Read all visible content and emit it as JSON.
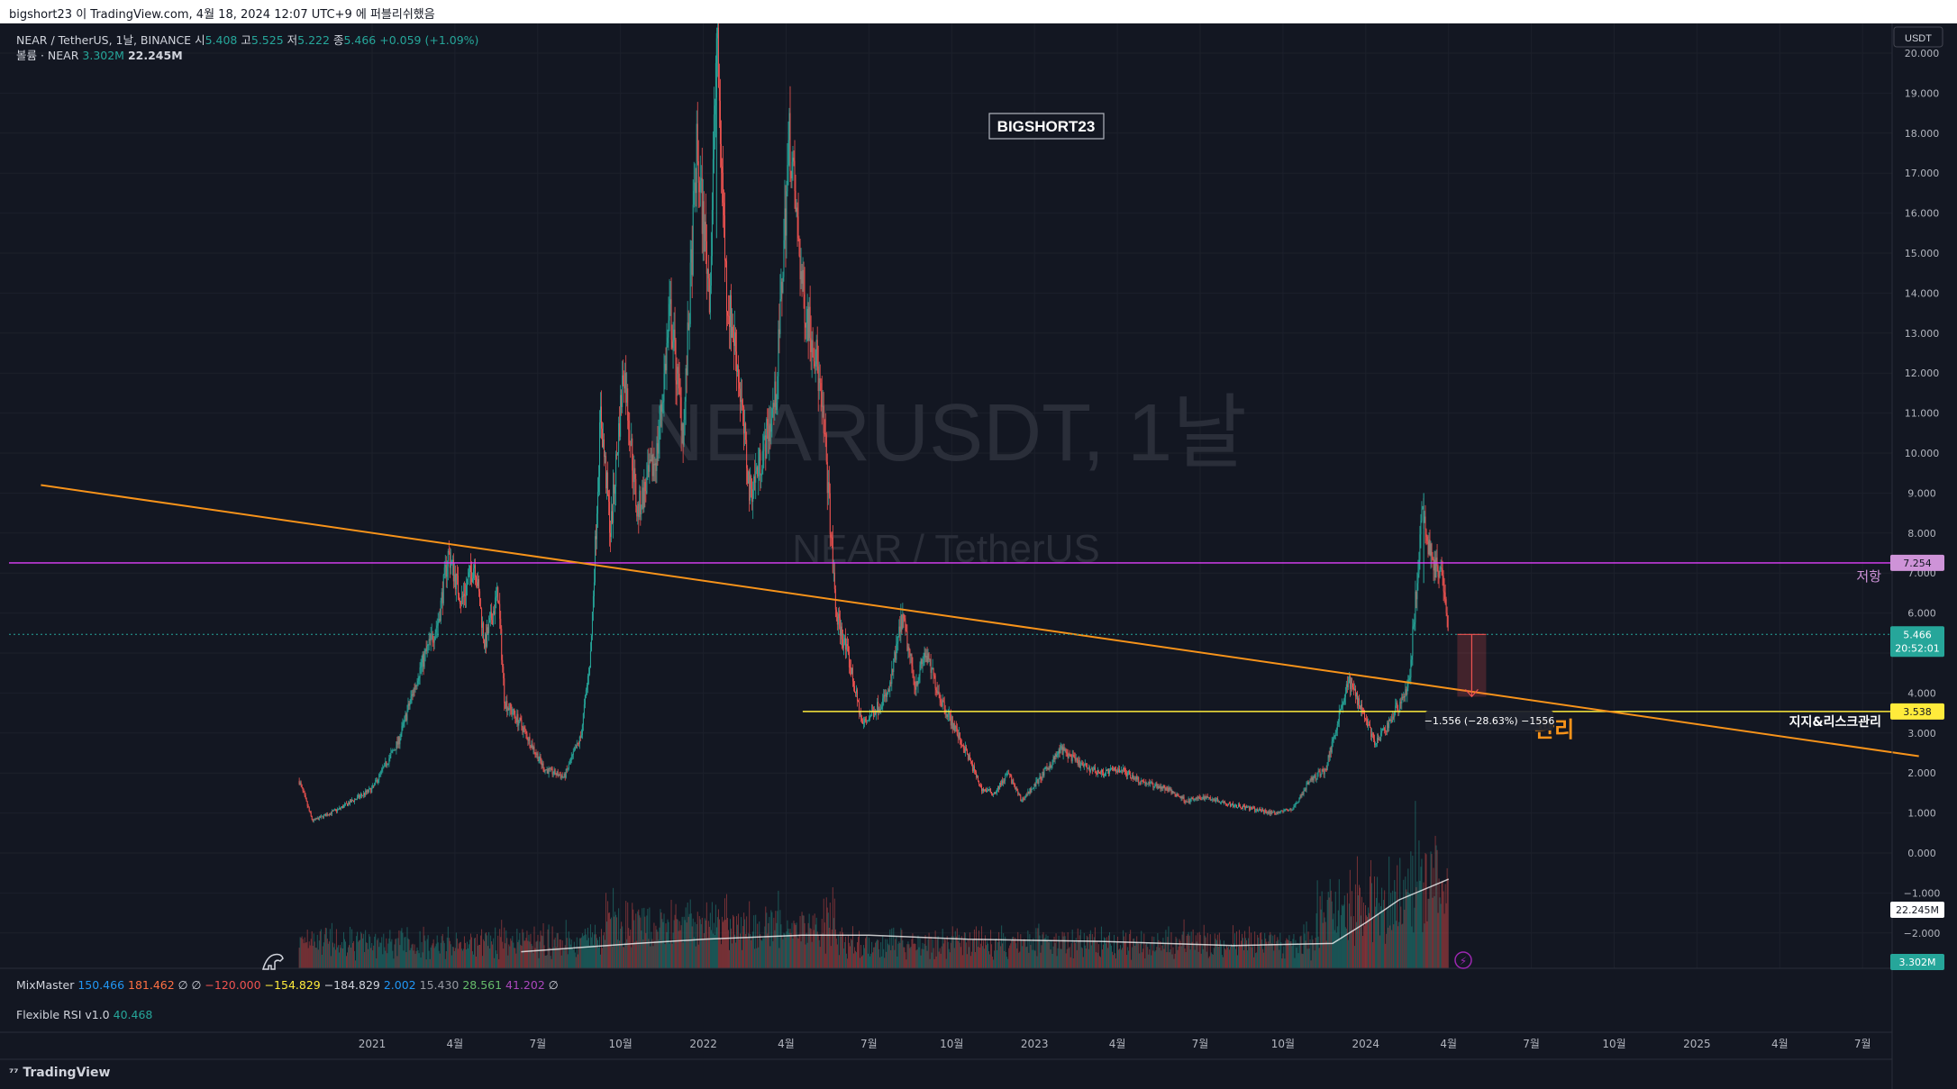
{
  "topbar": {
    "text": "bigshort23 이 TradingView.com, 4월 18, 2024 12:07 UTC+9 에 퍼블리쉬했음"
  },
  "legend": {
    "symbol": "NEAR / TetherUS, 1날, BINANCE",
    "open_label": "시",
    "open": "5.408",
    "high_label": "고",
    "high": "5.525",
    "low_label": "저",
    "low": "5.222",
    "close_label": "종",
    "close": "5.466",
    "change": "+0.059 (+1.09%)",
    "volume_label": "볼륨 · NEAR",
    "volume": "3.302M",
    "volume_ma": "22.245M"
  },
  "watermark": {
    "symbol": "NEARUSDT, 1날",
    "name": "NEAR / TetherUS"
  },
  "author_tag": "BIGSHORT23",
  "currency_button": "USDT",
  "annotations": {
    "resistance_label": "저항",
    "support_label": "지지&리스크관리",
    "support_orange_text": "관리",
    "measure": "−1.556 (−28.63%) −1556"
  },
  "price_tags": {
    "resistance": "7.254",
    "last_price": "5.466",
    "countdown": "20:52:01",
    "support": "3.538",
    "volume_ma": "22.245M",
    "volume": "3.302M"
  },
  "indicators": {
    "mixmaster_name": "MixMaster",
    "mixmaster_values": [
      {
        "v": "150.466",
        "c": "#2196f3"
      },
      {
        "v": "181.462",
        "c": "#ff7043"
      },
      {
        "v": "∅",
        "c": "#d1d4dc"
      },
      {
        "v": "∅",
        "c": "#d1d4dc"
      },
      {
        "v": "−120.000",
        "c": "#ef5350"
      },
      {
        "v": "−154.829",
        "c": "#ffeb3b"
      },
      {
        "v": "−184.829",
        "c": "#d1d4dc"
      },
      {
        "v": "2.002",
        "c": "#2196f3"
      },
      {
        "v": "15.430",
        "c": "#9598a1"
      },
      {
        "v": "28.561",
        "c": "#66bb6a"
      },
      {
        "v": "41.202",
        "c": "#ab47bc"
      },
      {
        "v": "∅",
        "c": "#d1d4dc"
      }
    ],
    "rsi_name": "Flexible RSI v1.0",
    "rsi_value": "40.468"
  },
  "footer": {
    "logo": "TradingView"
  },
  "colors": {
    "background": "#131722",
    "up": "#26a69a",
    "down": "#ef5350",
    "trendline": "#f7931a",
    "resistance": "#e040fb",
    "support": "#ffeb3b"
  },
  "chart_data": {
    "type": "candlestick",
    "title": "NEAR / TetherUS, 1날, BINANCE",
    "y_ticks": [
      "20.000",
      "19.000",
      "18.000",
      "17.000",
      "16.000",
      "15.000",
      "14.000",
      "13.000",
      "12.000",
      "11.000",
      "10.000",
      "9.000",
      "8.000",
      "7.000",
      "6.000",
      "5.000",
      "4.000",
      "3.000",
      "2.000",
      "1.000",
      "0.000",
      "−1.000",
      "−2.000"
    ],
    "ylim": [
      -2.5,
      20.5
    ],
    "x_ticks": [
      {
        "label": "2021",
        "t": 2021.0
      },
      {
        "label": "4월",
        "t": 2021.25
      },
      {
        "label": "7월",
        "t": 2021.5
      },
      {
        "label": "10월",
        "t": 2021.75
      },
      {
        "label": "2022",
        "t": 2022.0
      },
      {
        "label": "4월",
        "t": 2022.25
      },
      {
        "label": "7월",
        "t": 2022.5
      },
      {
        "label": "10월",
        "t": 2022.75
      },
      {
        "label": "2023",
        "t": 2023.0
      },
      {
        "label": "4월",
        "t": 2023.25
      },
      {
        "label": "7월",
        "t": 2023.5
      },
      {
        "label": "10월",
        "t": 2023.75
      },
      {
        "label": "2024",
        "t": 2024.0
      },
      {
        "label": "4월",
        "t": 2024.25
      },
      {
        "label": "7월",
        "t": 2024.5
      },
      {
        "label": "10월",
        "t": 2024.75
      },
      {
        "label": "2025",
        "t": 2025.0
      },
      {
        "label": "4월",
        "t": 2025.25
      },
      {
        "label": "7월",
        "t": 2025.5
      }
    ],
    "price_path": [
      [
        2020.78,
        1.8
      ],
      [
        2020.82,
        0.8
      ],
      [
        2020.9,
        1.1
      ],
      [
        2021.0,
        1.6
      ],
      [
        2021.08,
        2.8
      ],
      [
        2021.14,
        4.5
      ],
      [
        2021.2,
        5.8
      ],
      [
        2021.23,
        7.5
      ],
      [
        2021.27,
        6.3
      ],
      [
        2021.31,
        7.3
      ],
      [
        2021.34,
        5.2
      ],
      [
        2021.38,
        6.5
      ],
      [
        2021.4,
        3.8
      ],
      [
        2021.45,
        3.2
      ],
      [
        2021.52,
        2.1
      ],
      [
        2021.58,
        1.9
      ],
      [
        2021.63,
        2.9
      ],
      [
        2021.66,
        5.0
      ],
      [
        2021.69,
        11.0
      ],
      [
        2021.72,
        8.0
      ],
      [
        2021.76,
        12.2
      ],
      [
        2021.8,
        8.5
      ],
      [
        2021.86,
        10.0
      ],
      [
        2021.9,
        13.5
      ],
      [
        2021.94,
        10.5
      ],
      [
        2021.98,
        17.5
      ],
      [
        2022.02,
        14.0
      ],
      [
        2022.04,
        20.5
      ],
      [
        2022.07,
        14.0
      ],
      [
        2022.1,
        12.5
      ],
      [
        2022.14,
        9.0
      ],
      [
        2022.18,
        10.0
      ],
      [
        2022.22,
        11.5
      ],
      [
        2022.26,
        18.0
      ],
      [
        2022.3,
        14.0
      ],
      [
        2022.34,
        12.5
      ],
      [
        2022.37,
        10.0
      ],
      [
        2022.4,
        6.0
      ],
      [
        2022.44,
        4.8
      ],
      [
        2022.48,
        3.2
      ],
      [
        2022.52,
        3.6
      ],
      [
        2022.56,
        4.0
      ],
      [
        2022.6,
        5.9
      ],
      [
        2022.64,
        4.2
      ],
      [
        2022.67,
        5.0
      ],
      [
        2022.72,
        3.8
      ],
      [
        2022.76,
        3.1
      ],
      [
        2022.8,
        2.4
      ],
      [
        2022.84,
        1.6
      ],
      [
        2022.88,
        1.5
      ],
      [
        2022.92,
        2.0
      ],
      [
        2022.96,
        1.3
      ],
      [
        2023.02,
        1.9
      ],
      [
        2023.08,
        2.6
      ],
      [
        2023.14,
        2.2
      ],
      [
        2023.2,
        2.0
      ],
      [
        2023.26,
        2.1
      ],
      [
        2023.32,
        1.8
      ],
      [
        2023.4,
        1.6
      ],
      [
        2023.46,
        1.3
      ],
      [
        2023.52,
        1.4
      ],
      [
        2023.6,
        1.2
      ],
      [
        2023.66,
        1.1
      ],
      [
        2023.72,
        1.0
      ],
      [
        2023.78,
        1.1
      ],
      [
        2023.83,
        1.8
      ],
      [
        2023.88,
        2.1
      ],
      [
        2023.92,
        3.5
      ],
      [
        2023.95,
        4.3
      ],
      [
        2023.99,
        3.6
      ],
      [
        2024.03,
        2.7
      ],
      [
        2024.08,
        3.4
      ],
      [
        2024.13,
        4.2
      ],
      [
        2024.17,
        8.4
      ],
      [
        2024.2,
        7.4
      ],
      [
        2024.24,
        6.6
      ],
      [
        2024.25,
        5.5
      ]
    ],
    "highlights": {
      "peak": {
        "t": 2022.04,
        "high": 20.5
      },
      "recent_high": {
        "t": 2024.175,
        "high": 9.0
      },
      "last": {
        "t": 2024.25,
        "close": 5.466
      }
    },
    "resistance_level": 7.254,
    "support_level": 3.538,
    "support_level_from": 2022.3,
    "trendline": {
      "from": [
        2020.0,
        9.2
      ],
      "to": [
        2025.67,
        2.42
      ]
    },
    "measure": {
      "t": 2024.32,
      "from": 5.466,
      "to": 3.91,
      "change": -1.556,
      "percent": -28.63
    },
    "volume": {
      "label": "볼륨 · NEAR",
      "last": "3.302M",
      "ma": "22.245M",
      "ma_path": [
        [
          2021.45,
          0.08
        ],
        [
          2021.8,
          0.12
        ],
        [
          2022.0,
          0.14
        ],
        [
          2022.3,
          0.16
        ],
        [
          2022.5,
          0.16
        ],
        [
          2022.8,
          0.14
        ],
        [
          2023.2,
          0.13
        ],
        [
          2023.6,
          0.11
        ],
        [
          2023.9,
          0.12
        ],
        [
          2024.0,
          0.22
        ],
        [
          2024.1,
          0.33
        ],
        [
          2024.25,
          0.43
        ]
      ]
    }
  }
}
